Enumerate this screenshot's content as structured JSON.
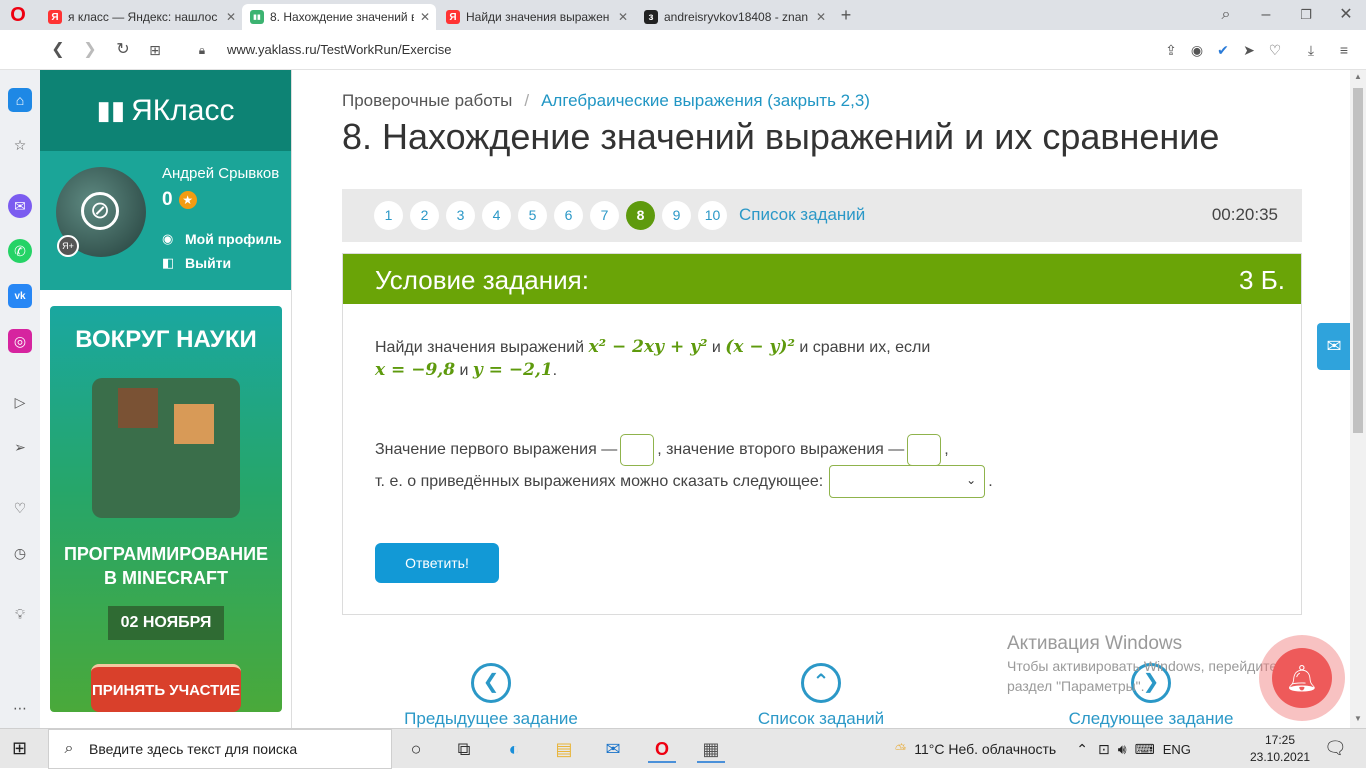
{
  "browser": {
    "tabs": [
      {
        "label": "я класс — Яндекс: нашлос",
        "favicon": "Я",
        "color": "#f33"
      },
      {
        "label": "8. Нахождение значений в",
        "favicon": "▮▮",
        "color": "#3cb371"
      },
      {
        "label": "Найди значения выражен",
        "favicon": "Я",
        "color": "#f33"
      },
      {
        "label": "andreisryvkov18408 - znan",
        "favicon": "з",
        "color": "#222"
      }
    ],
    "url": "www.yaklass.ru/TestWorkRun/Exercise"
  },
  "site": {
    "logo": "ЯКласс",
    "user": {
      "name": "Андрей Срывков",
      "points": "0",
      "profile_link": "Мой профиль",
      "logout_link": "Выйти"
    },
    "banner": {
      "title": "ВОКРУГ НАУКИ",
      "subtitle_line1": "ПРОГРАММИРОВАНИЕ",
      "subtitle_line2": "В MINECRAFT",
      "date": "02 НОЯБРЯ",
      "button": "ПРИНЯТЬ УЧАСТИЕ"
    }
  },
  "page": {
    "breadcrumb_root": "Проверочные работы",
    "breadcrumb_sep": "/",
    "breadcrumb_current": "Алгебраические выражения (закрыть 2,3)",
    "title": "8. Нахождение значений выражений и их сравнение",
    "pager": {
      "numbers": [
        "1",
        "2",
        "3",
        "4",
        "5",
        "6",
        "7",
        "8",
        "9",
        "10"
      ],
      "current": "8",
      "task_list_link": "Список заданий",
      "timer": "00:20:35"
    },
    "task": {
      "header": "Условие задания:",
      "points": "3 Б.",
      "q_text1": "Найди значения выражений",
      "q_and1": "и",
      "q_text2": "и сравни их, если",
      "q_and2": "и",
      "expr1": "x² − 2xy + y²",
      "expr2": "(x − y)²",
      "cond_x": "x = −9,8",
      "cond_y": "y = −2,1",
      "line2_a": "Значение первого выражения —",
      "line2_b": ", значение второго выражения —",
      "line2_c": ",",
      "line3": "т. е. о приведённых выражениях можно сказать следующее:",
      "line3_end": ".",
      "answer_button": "Ответить!"
    },
    "bottom_nav": {
      "prev": "Предыдущее задание",
      "list": "Список заданий",
      "next": "Следующее задание"
    }
  },
  "watermark": {
    "title": "Активация Windows",
    "line1": "Чтобы активировать Windows, перейдите в",
    "line2": "раздел \"Параметры\"."
  },
  "taskbar": {
    "search_placeholder": "Введите здесь текст для поиска",
    "weather": "11°C  Неб. облачность",
    "lang": "ENG",
    "time": "17:25",
    "date": "23.10.2021"
  }
}
